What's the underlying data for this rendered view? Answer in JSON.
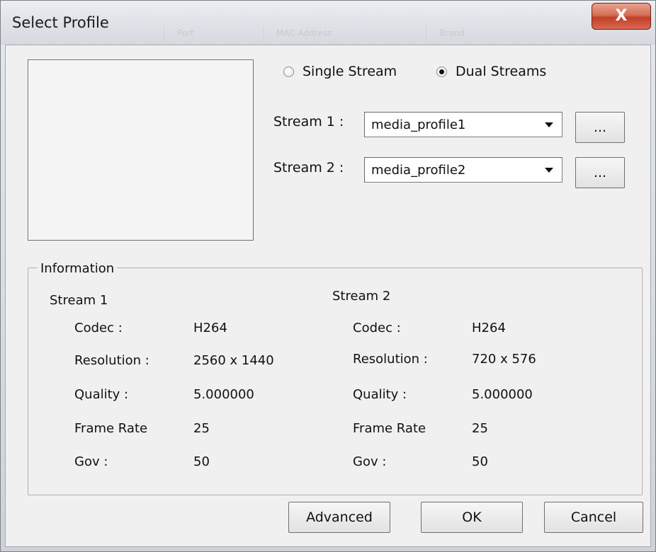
{
  "window": {
    "title": "Select Profile",
    "background_tabs": [
      "Port",
      "MAC Address",
      "Brand"
    ]
  },
  "close_glyph": "X",
  "stream_mode": {
    "options": [
      {
        "label": "Single Stream",
        "checked": false
      },
      {
        "label": "Dual Streams",
        "checked": true
      }
    ]
  },
  "streams": [
    {
      "label": "Stream 1 :",
      "selected": "media_profile1",
      "more_label": "..."
    },
    {
      "label": "Stream 2 :",
      "selected": "media_profile2",
      "more_label": "..."
    }
  ],
  "information": {
    "title": "Information",
    "stream1": {
      "heading": "Stream 1",
      "rows": [
        {
          "label": "Codec :",
          "value": "H264"
        },
        {
          "label": "Resolution :",
          "value": "2560 x 1440"
        },
        {
          "label": "Quality :",
          "value": "5.000000"
        },
        {
          "label": "Frame Rate",
          "value": "25"
        },
        {
          "label": "Gov :",
          "value": "50"
        }
      ]
    },
    "stream2": {
      "heading": "Stream 2",
      "rows": [
        {
          "label": "Codec :",
          "value": "H264"
        },
        {
          "label": "Resolution :",
          "value": "720 x 576"
        },
        {
          "label": "Quality :",
          "value": "5.000000"
        },
        {
          "label": "Frame Rate",
          "value": "25"
        },
        {
          "label": "Gov :",
          "value": "50"
        }
      ]
    }
  },
  "buttons": {
    "advanced": "Advanced",
    "ok": "OK",
    "cancel": "Cancel"
  },
  "colors": {
    "close_button": "#c2402a",
    "dialog_bg": "#f0f0f0"
  }
}
